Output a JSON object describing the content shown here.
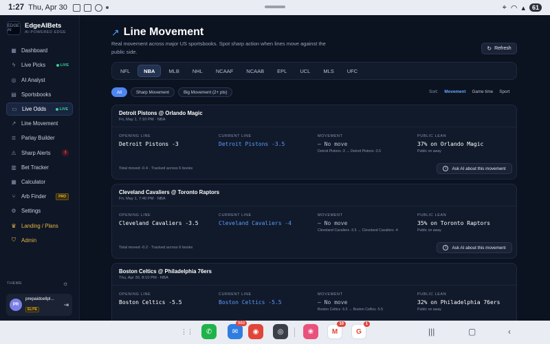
{
  "status_bar": {
    "time": "1:27",
    "date": "Thu, Apr 30",
    "battery": "61"
  },
  "sidebar": {
    "brand": {
      "logo_text": "EDGE AI",
      "name": "EdgeAIBets",
      "tagline": "AI-POWERED EDGE"
    },
    "items": [
      {
        "label": "Dashboard",
        "icon": "grid-icon",
        "glyph": "▦"
      },
      {
        "label": "Live Picks",
        "icon": "zap-icon",
        "glyph": "ϟ",
        "badge": "LIVE"
      },
      {
        "label": "AI Analyst",
        "icon": "bot-icon",
        "glyph": "◎"
      },
      {
        "label": "Sportsbooks",
        "icon": "book-icon",
        "glyph": "▤"
      },
      {
        "label": "Live Odds",
        "icon": "monitor-icon",
        "glyph": "▭",
        "badge": "LIVE",
        "active": true
      },
      {
        "label": "Line Movement",
        "icon": "trend-icon",
        "glyph": "↗"
      },
      {
        "label": "Parlay Builder",
        "icon": "layers-icon",
        "glyph": "≣"
      },
      {
        "label": "Sharp Alerts",
        "icon": "bell-icon",
        "glyph": "⚠",
        "count": "3"
      },
      {
        "label": "Bet Tracker",
        "icon": "chart-icon",
        "glyph": "▥"
      },
      {
        "label": "Calculator",
        "icon": "calculator-icon",
        "glyph": "▦"
      },
      {
        "label": "Arb Finder",
        "icon": "split-icon",
        "glyph": "⑂",
        "pro": "PRO"
      },
      {
        "label": "Settings",
        "icon": "gear-icon",
        "glyph": "⚙"
      },
      {
        "label": "Landing / Plans",
        "icon": "crown-icon",
        "glyph": "♛",
        "gold": true
      },
      {
        "label": "Admin",
        "icon": "shield-icon",
        "glyph": "⛉",
        "gold": true
      }
    ],
    "theme_label": "THEME",
    "user": {
      "initials": "PR",
      "name": "prepaidcellpl...",
      "tier": "ELITE"
    }
  },
  "main": {
    "title": "Line Movement",
    "subtitle": "Real movement across major US sportsbooks. Spot sharp action when lines move against the public side.",
    "refresh_label": "Refresh",
    "leagues": [
      "NFL",
      "NBA",
      "MLB",
      "NHL",
      "NCAAF",
      "NCAAB",
      "EPL",
      "UCL",
      "MLS",
      "UFC"
    ],
    "active_league": "NBA",
    "filters": [
      "All",
      "Sharp Movement",
      "Big Movement (2+ pts)"
    ],
    "sort": {
      "label": "Sort:",
      "options": [
        "Movement",
        "Game time",
        "Sport"
      ],
      "active": "Movement"
    },
    "column_labels": {
      "opening": "OPENING LINE",
      "current": "CURRENT LINE",
      "movement": "MOVEMENT",
      "public": "PUBLIC LEAN"
    },
    "ask_label": "Ask AI about this movement",
    "games": [
      {
        "matchup": "Detroit Pistons @ Orlando Magic",
        "when": "Fri, May 1, 7:10 PM · NBA",
        "opening": "Detroit Pistons -3",
        "current": "Detroit Pistons -3.5",
        "movement": "— No move",
        "movement_detail": "Detroit Pistons -3 → Detroit Pistons -3.5",
        "public": "37% on Orlando Magic",
        "public_sub": "Public on away",
        "note": "Total moved -0.4 · Tracked across 6 books"
      },
      {
        "matchup": "Cleveland Cavaliers @ Toronto Raptors",
        "when": "Fri, May 1, 7:40 PM · NBA",
        "opening": "Cleveland Cavaliers -3.5",
        "current": "Cleveland Cavaliers -4",
        "movement": "— No move",
        "movement_detail": "Cleveland Cavaliers -3.5 → Cleveland Cavaliers -4",
        "public": "35% on Toronto Raptors",
        "public_sub": "Public on away",
        "note": "Total moved -0.2 · Tracked across 6 books"
      },
      {
        "matchup": "Boston Celtics @ Philadelphia 76ers",
        "when": "Thu, Apr 30, 8:10 PM · NBA",
        "opening": "Boston Celtics -5.5",
        "current": "Boston Celtics -5.5",
        "movement": "— No move",
        "movement_detail": "Boston Celtics -5.5 → Boston Celtics -5.5",
        "public": "32% on Philadelphia 76ers",
        "public_sub": "Public on away",
        "note": ""
      }
    ]
  },
  "dock": {
    "apps": [
      {
        "name": "apps-grid",
        "glyph": "⋮⋮"
      },
      {
        "name": "phone",
        "glyph": "✆",
        "color": "#1fb34a"
      },
      {
        "name": "mail",
        "glyph": "✉",
        "color": "#2f7de1",
        "count": "983"
      },
      {
        "name": "chrome",
        "glyph": "◉",
        "color": "#e0453a"
      },
      {
        "name": "camera",
        "glyph": "◎",
        "color": "#3a3f48"
      },
      {
        "name": "gallery",
        "glyph": "❀",
        "color": "#e9527d"
      },
      {
        "name": "gmail",
        "glyph": "M",
        "color": "#ffffff",
        "count": "10"
      },
      {
        "name": "google",
        "glyph": "G",
        "color": "#ffffff",
        "count": "1"
      }
    ]
  }
}
